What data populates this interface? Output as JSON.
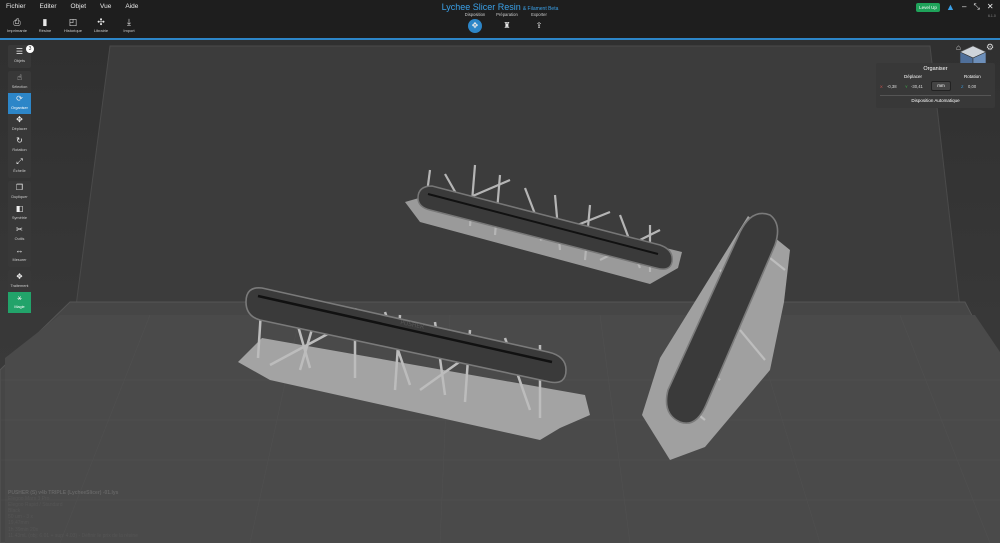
{
  "menu": [
    "Fichier",
    "Editer",
    "Objet",
    "Vue",
    "Aide"
  ],
  "app": {
    "title": "Lychee Slicer Resin",
    "subtitle": "& Filament Beta",
    "version": "6.1.0"
  },
  "quickbar": [
    {
      "label": "Imprimante",
      "icon": "printer-icon",
      "glyph": "⎙"
    },
    {
      "label": "Résine",
      "icon": "resin-bottle-icon",
      "glyph": "▮"
    },
    {
      "label": "Historique",
      "icon": "history-icon",
      "glyph": "◰"
    },
    {
      "label": "Librairie",
      "icon": "library-icon",
      "glyph": "✣"
    },
    {
      "label": "Import",
      "icon": "import-icon",
      "glyph": "⤓"
    }
  ],
  "modes": [
    {
      "label": "Disposition",
      "icon": "disposition-icon",
      "glyph": "✥",
      "active": true
    },
    {
      "label": "Préparation",
      "icon": "preparation-icon",
      "glyph": "♜",
      "active": false
    },
    {
      "label": "Exporter",
      "icon": "export-icon",
      "glyph": "⇪",
      "active": false
    }
  ],
  "level_up": "Level Up",
  "left_tools": {
    "object_count": "3",
    "groups": [
      [
        {
          "label": "Objets",
          "icon": "objects-list-icon",
          "glyph": "☰",
          "state": ""
        }
      ],
      [
        {
          "label": "Sélection",
          "icon": "selection-icon",
          "glyph": "☝",
          "state": ""
        },
        {
          "label": "Organiser",
          "icon": "organize-icon",
          "glyph": "⟳",
          "state": "active"
        },
        {
          "label": "Déplacer",
          "icon": "move-icon",
          "glyph": "✥",
          "state": ""
        },
        {
          "label": "Rotation",
          "icon": "rotation-icon",
          "glyph": "↻",
          "state": ""
        },
        {
          "label": "Échelle",
          "icon": "scale-icon",
          "glyph": "⤢",
          "state": ""
        }
      ],
      [
        {
          "label": "Dupliquer",
          "icon": "duplicate-icon",
          "glyph": "❐",
          "state": ""
        },
        {
          "label": "Symétrie",
          "icon": "mirror-icon",
          "glyph": "◧",
          "state": ""
        },
        {
          "label": "Outils",
          "icon": "scissors-icon",
          "glyph": "✂",
          "state": ""
        },
        {
          "label": "Mesurer",
          "icon": "measure-icon",
          "glyph": "↔",
          "state": ""
        }
      ],
      [
        {
          "label": "Traitement",
          "icon": "processing-icon",
          "glyph": "❖",
          "state": ""
        },
        {
          "label": "Magie",
          "icon": "magic-icon",
          "glyph": "⚹",
          "state": "green"
        }
      ]
    ]
  },
  "panel": {
    "title": "Organiser",
    "move_header": "Déplacer",
    "rotation_header": "Rotation",
    "x_value": "-0,38",
    "y_value": "-30,41",
    "unit": "mm",
    "rotation_value": "0,00",
    "auto_button": "Disposition Automatique",
    "colors": {
      "x": "#d9534f",
      "y": "#3ab54a",
      "z": "#3aa0e8"
    }
  },
  "info": {
    "filename": "PUSHER (S) v4b TRIPLE (LycheeSlicer) -01.lys",
    "lines": [
      "Elegoo Mars 3 Pro",
      "Elegoo Rapid / Standard",
      "Black",
      "50 um - 3 x",
      "19,47mm",
      "1h 39min 20s",
      "11.43mL (obj: 6.01 + sup: 4.03) - Définir le prix de la résine"
    ]
  },
  "accent": "#2d86c8"
}
